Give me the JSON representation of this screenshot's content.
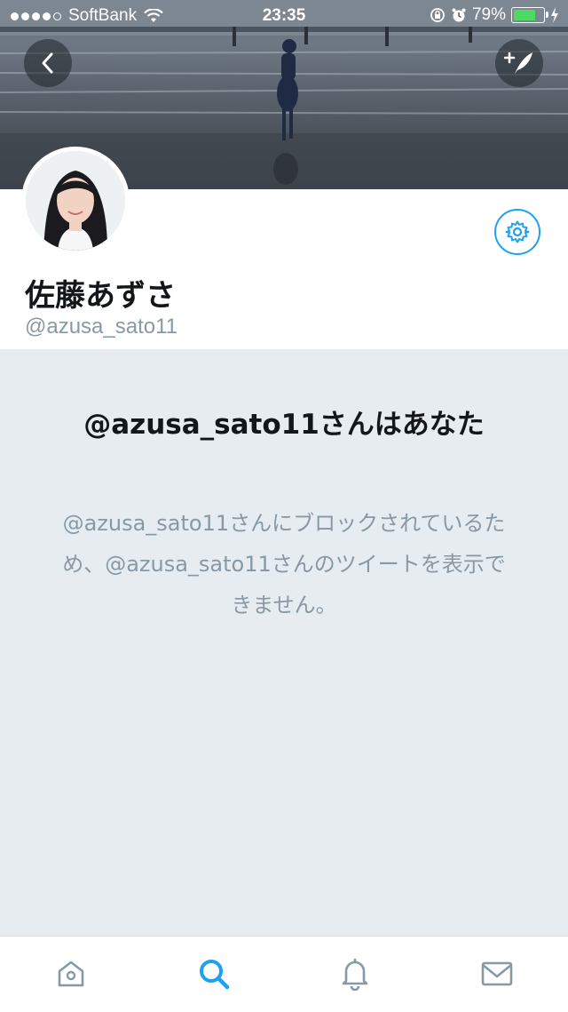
{
  "status_bar": {
    "signal_dots_filled": 4,
    "signal_dots_total": 5,
    "carrier": "SoftBank",
    "time": "23:35",
    "battery_percent": "79%",
    "battery_level": 0.79
  },
  "header": {
    "back_icon": "chevron-left-icon",
    "compose_icon": "compose-tweet-icon"
  },
  "profile": {
    "display_name": "佐藤あずさ",
    "handle": "@azusa_sato11",
    "settings_icon": "gear-icon"
  },
  "blocked": {
    "title": "@azusa_sato11さんはあなた",
    "message": "@azusa_sato11さんにブロックされているため、@azusa_sato11さんのツイートを表示できません。"
  },
  "tabbar": {
    "items": [
      {
        "name": "home",
        "icon": "home-icon",
        "active": false
      },
      {
        "name": "search",
        "icon": "search-icon",
        "active": true
      },
      {
        "name": "notifications",
        "icon": "bell-icon",
        "active": false
      },
      {
        "name": "messages",
        "icon": "envelope-icon",
        "active": false
      }
    ]
  },
  "colors": {
    "accent": "#1da1f2",
    "background": "#e6ecf0",
    "muted_text": "#8899a6",
    "battery": "#4cd964"
  }
}
